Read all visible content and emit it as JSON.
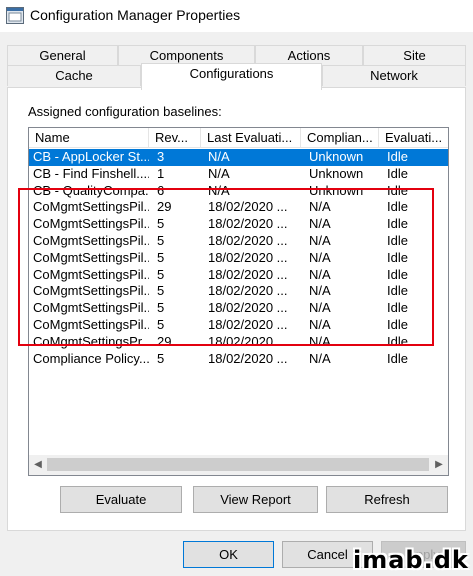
{
  "window": {
    "title": "Configuration Manager Properties",
    "icon": "app-window-icon"
  },
  "tabs": {
    "row1": [
      "General",
      "Components",
      "Actions",
      "Site"
    ],
    "row2": [
      "Cache",
      "Configurations",
      "Network"
    ],
    "active": "Configurations"
  },
  "panel": {
    "label": "Assigned configuration baselines:"
  },
  "columns": [
    "Name",
    "Rev...",
    "Last Evaluati...",
    "Complian...",
    "Evaluati..."
  ],
  "rows": [
    [
      "CB - AppLocker St...",
      "3",
      "N/A",
      "Unknown",
      "Idle"
    ],
    [
      "CB - Find Finshell....",
      "1",
      "N/A",
      "Unknown",
      "Idle"
    ],
    [
      "CB - QualityCompa...",
      "6",
      "N/A",
      "Unknown",
      "Idle"
    ],
    [
      "CoMgmtSettingsPil...",
      "29",
      "18/02/2020 ...",
      "N/A",
      "Idle"
    ],
    [
      "CoMgmtSettingsPil...",
      "5",
      "18/02/2020 ...",
      "N/A",
      "Idle"
    ],
    [
      "CoMgmtSettingsPil...",
      "5",
      "18/02/2020 ...",
      "N/A",
      "Idle"
    ],
    [
      "CoMgmtSettingsPil...",
      "5",
      "18/02/2020 ...",
      "N/A",
      "Idle"
    ],
    [
      "CoMgmtSettingsPil...",
      "5",
      "18/02/2020 ...",
      "N/A",
      "Idle"
    ],
    [
      "CoMgmtSettingsPil...",
      "5",
      "18/02/2020 ...",
      "N/A",
      "Idle"
    ],
    [
      "CoMgmtSettingsPil...",
      "5",
      "18/02/2020 ...",
      "N/A",
      "Idle"
    ],
    [
      "CoMgmtSettingsPil...",
      "5",
      "18/02/2020 ...",
      "N/A",
      "Idle"
    ],
    [
      "CoMgmtSettingsPr...",
      "29",
      "18/02/2020 ...",
      "N/A",
      "Idle"
    ],
    [
      "Compliance Policy...",
      "5",
      "18/02/2020 ...",
      "N/A",
      "Idle"
    ]
  ],
  "selected_row": 0,
  "actions": {
    "evaluate": "Evaluate",
    "view_report": "View Report",
    "refresh": "Refresh"
  },
  "footer": {
    "ok": "OK",
    "cancel": "Cancel",
    "apply": "Apply"
  },
  "watermark": "imab.dk",
  "colors": {
    "selection": "#0078d7",
    "highlight_box": "#e3000f"
  }
}
